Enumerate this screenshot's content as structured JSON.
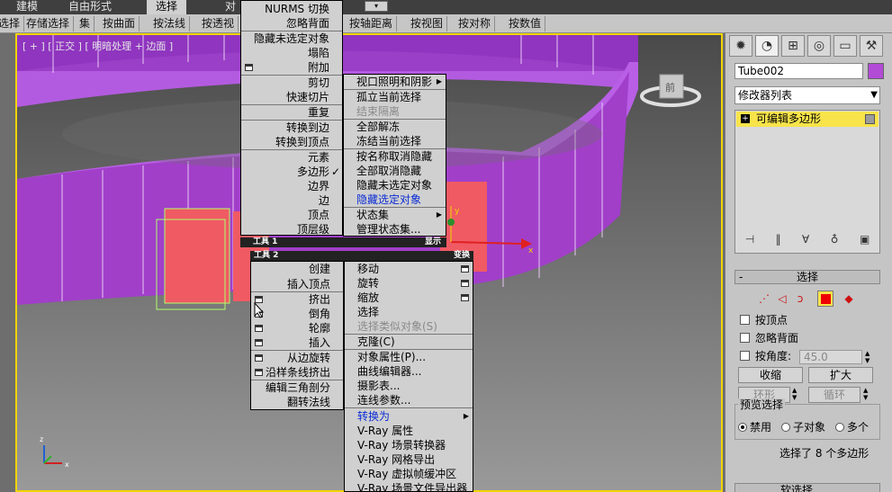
{
  "ribbon": {
    "tabs": [
      "建模",
      "自由形式",
      "选择",
      "对"
    ],
    "buttons": [
      "选择",
      "存储选择",
      "集",
      "按曲面",
      "按法线",
      "按透视",
      "按轴距离",
      "按视图",
      "按对称",
      "按数值"
    ]
  },
  "viewport": {
    "label": "[ + ] [ 正交 ] [ 明暗处理 + 边面 ]",
    "viewcube_label": "前"
  },
  "quad_left": {
    "items": [
      "NURMS 切换",
      "忽略背面",
      "隐藏未选定对象",
      "塌陷",
      "附加",
      "剪切",
      "快速切片",
      "重复",
      "转换到边",
      "转换到顶点",
      "元素",
      "多边形",
      "边界",
      "边",
      "顶点",
      "顶层级"
    ],
    "header": "工具 1",
    "header_right": "显示"
  },
  "quad_right_top": {
    "items": [
      "视口照明和阴影",
      "孤立当前选择",
      "结束隔离",
      "全部解冻",
      "冻结当前选择",
      "按名称取消隐藏",
      "全部取消隐藏",
      "隐藏未选定对象",
      "隐藏选定对象",
      "状态集",
      "管理状态集..."
    ]
  },
  "quad_bottom_left": {
    "header": "工具 2",
    "items": [
      "创建",
      "插入顶点",
      "挤出",
      "倒角",
      "轮廓",
      "插入",
      "从边旋转",
      "沿样条线挤出",
      "编辑三角剖分",
      "翻转法线"
    ]
  },
  "quad_bottom_right": {
    "header": "变换",
    "items": [
      "移动",
      "旋转",
      "缩放",
      "选择",
      "选择类似对象(S)",
      "克隆(C)",
      "对象属性(P)...",
      "曲线编辑器...",
      "摄影表...",
      "连线参数...",
      "转换为",
      "V-Ray 属性",
      "V-Ray 场景转换器",
      "V-Ray 网格导出",
      "V-Ray 虚拟帧缓冲区",
      "V-Ray 场景文件导出器"
    ]
  },
  "panel": {
    "object_name": "Tube002",
    "modifier_list": "修改器列表",
    "stack_item": "可编辑多边形",
    "rollout_title": "选择",
    "checkboxes": [
      "按顶点",
      "忽略背面",
      "按角度:"
    ],
    "angle_value": "45.0",
    "shrink": "收缩",
    "grow": "扩大",
    "ring": "环形",
    "loop": "循环",
    "preview_title": "预览选择",
    "preview_options": [
      "禁用",
      "子对象",
      "多个"
    ],
    "status": "选择了 8 个多边形",
    "next_rollout": "软选择"
  },
  "colors": {
    "accent_yellow": "#f8e44a",
    "tube_purple": "#a13fc9",
    "selected_red": "#f05a63"
  }
}
